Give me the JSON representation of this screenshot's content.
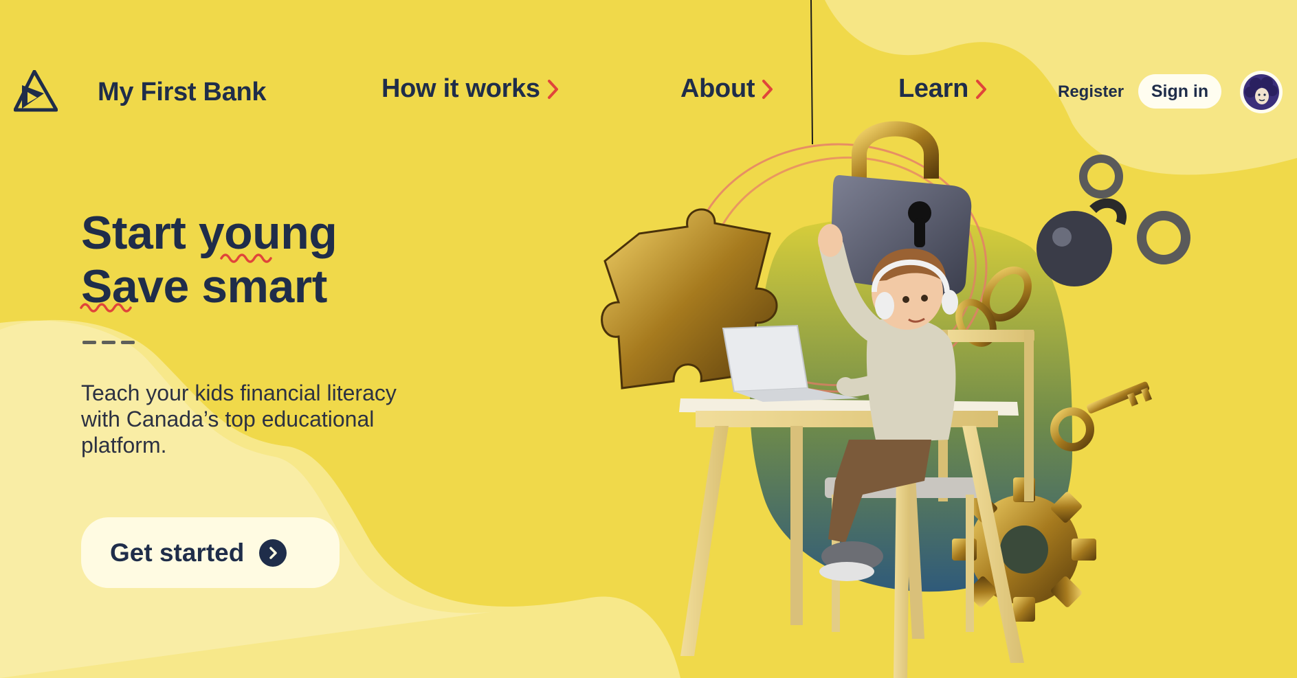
{
  "brand": {
    "name": "My First Bank"
  },
  "nav": {
    "items": [
      {
        "label": "How it works"
      },
      {
        "label": "About"
      },
      {
        "label": "Learn"
      }
    ],
    "register_label": "Register",
    "signin_label": "Sign in"
  },
  "hero": {
    "headline_line1": "Start young",
    "headline_line2": "Save smart",
    "subtitle": "Teach your kids financial literacy with Canada’s top educational platform.",
    "cta_label": "Get started"
  },
  "colors": {
    "background": "#f0d94a",
    "navy": "#1f2d4a",
    "accent_red": "#e0453a",
    "cream": "#fffbe2"
  },
  "icons": [
    "logo-icon",
    "chevron-right-icon",
    "avatar-icon",
    "arrow-circle-icon"
  ]
}
